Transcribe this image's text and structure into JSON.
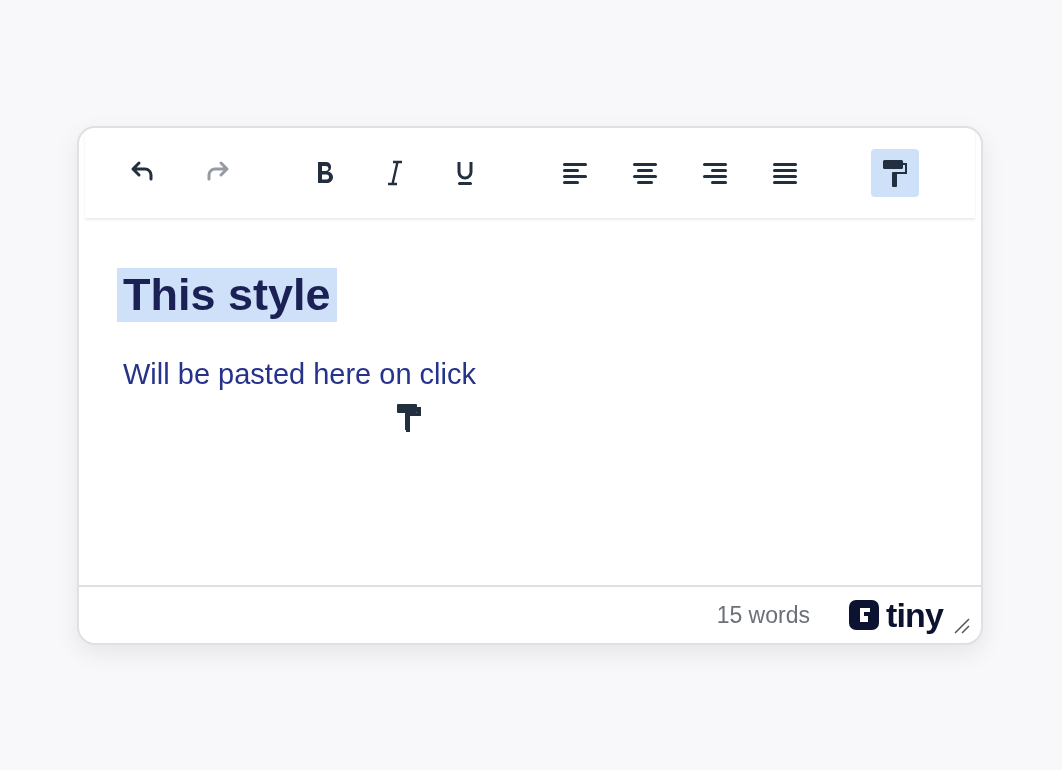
{
  "toolbar": {
    "groups": [
      {
        "buttons": [
          {
            "kind": "undo",
            "disabled": false,
            "selected": false
          },
          {
            "kind": "redo",
            "disabled": true,
            "selected": false
          }
        ]
      },
      {
        "buttons": [
          {
            "kind": "bold",
            "disabled": false,
            "selected": false
          },
          {
            "kind": "italic",
            "disabled": false,
            "selected": false
          },
          {
            "kind": "underline",
            "disabled": false,
            "selected": false
          }
        ]
      },
      {
        "buttons": [
          {
            "kind": "align-left",
            "disabled": false,
            "selected": false
          },
          {
            "kind": "align-center",
            "disabled": false,
            "selected": false
          },
          {
            "kind": "align-right",
            "disabled": false,
            "selected": false
          },
          {
            "kind": "justify",
            "disabled": false,
            "selected": false
          }
        ]
      },
      {
        "buttons": [
          {
            "kind": "format-painter",
            "disabled": false,
            "selected": true
          }
        ]
      }
    ]
  },
  "content": {
    "heading": {
      "text": "This style",
      "selected": true
    },
    "paragraph": "Will be pasted here on click"
  },
  "status_bar": {
    "word_count": "15 words",
    "logo_text": "tiny"
  }
}
